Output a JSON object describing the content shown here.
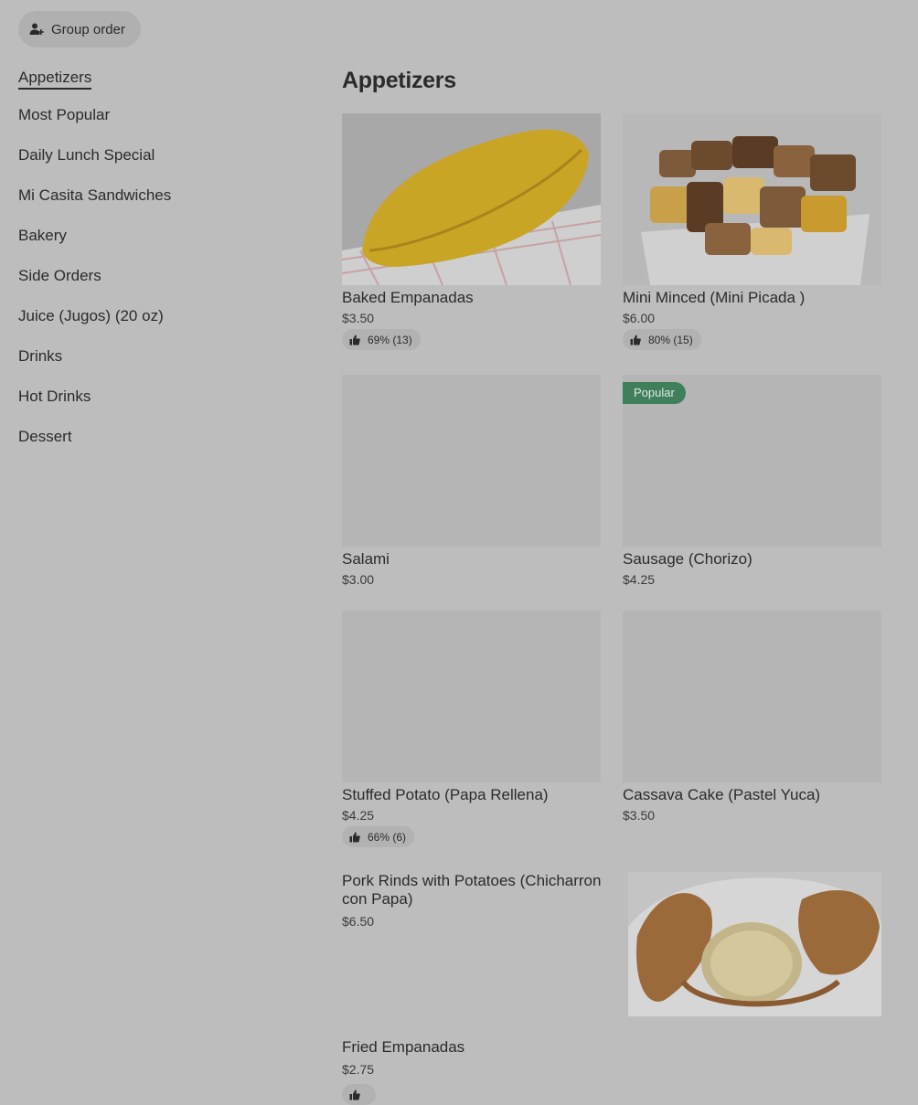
{
  "header": {
    "group_order_label": "Group order"
  },
  "sidebar": {
    "items": [
      {
        "label": "Appetizers"
      },
      {
        "label": "Most Popular"
      },
      {
        "label": "Daily Lunch Special"
      },
      {
        "label": "Mi Casita Sandwiches"
      },
      {
        "label": "Bakery"
      },
      {
        "label": "Side Orders"
      },
      {
        "label": "Juice (Jugos) (20 oz)"
      },
      {
        "label": "Drinks"
      },
      {
        "label": "Hot Drinks"
      },
      {
        "label": "Dessert"
      }
    ]
  },
  "main": {
    "section_title": "Appetizers",
    "cards": [
      {
        "name": "Baked Empanadas",
        "price": "$3.50",
        "rating": "69% (13)"
      },
      {
        "name": "Mini Minced (Mini Picada )",
        "price": "$6.00",
        "rating": "80% (15)"
      },
      {
        "name": "Salami",
        "price": "$3.00"
      },
      {
        "name": "Sausage (Chorizo)",
        "price": "$4.25",
        "badge": "Popular"
      },
      {
        "name": "Stuffed Potato (Papa Rellena)",
        "price": "$4.25",
        "rating": "66% (6)"
      },
      {
        "name": "Cassava Cake (Pastel Yuca)",
        "price": "$3.50"
      }
    ],
    "rows": [
      {
        "name": "Pork Rinds with Potatoes (Chicharron con Papa)",
        "price": "$6.50"
      },
      {
        "name": "Fried Empanadas",
        "price": "$2.75"
      }
    ]
  },
  "icons": {
    "group": "add-person-icon",
    "rating": "thumbs-up-icon"
  }
}
